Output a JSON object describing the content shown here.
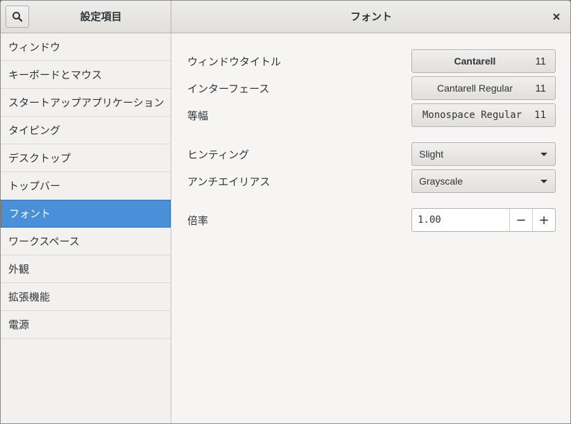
{
  "header": {
    "left_title": "設定項目",
    "right_title": "フォント",
    "search_icon": "search-icon",
    "close_icon": "close-icon"
  },
  "sidebar": {
    "items": [
      {
        "label": "ウィンドウ"
      },
      {
        "label": "キーボードとマウス"
      },
      {
        "label": "スタートアップアプリケーション"
      },
      {
        "label": "タイピング"
      },
      {
        "label": "デスクトップ"
      },
      {
        "label": "トップバー"
      },
      {
        "label": "フォント",
        "selected": true
      },
      {
        "label": "ワークスペース"
      },
      {
        "label": "外観"
      },
      {
        "label": "拡張機能"
      },
      {
        "label": "電源"
      }
    ],
    "selected_color": "#4a90d9"
  },
  "fonts": {
    "window_title": {
      "label": "ウィンドウタイトル",
      "font": "Cantarell",
      "size": "11"
    },
    "interface": {
      "label": "インターフェース",
      "font": "Cantarell Regular",
      "size": "11"
    },
    "monospace": {
      "label": "等幅",
      "font": "Monospace Regular",
      "size": "11"
    }
  },
  "rendering": {
    "hinting": {
      "label": "ヒンティング",
      "value": "Slight"
    },
    "antialiasing": {
      "label": "アンチエイリアス",
      "value": "Grayscale"
    }
  },
  "scaling": {
    "label": "倍率",
    "value": "1.00",
    "minus": "−",
    "plus": "+"
  }
}
